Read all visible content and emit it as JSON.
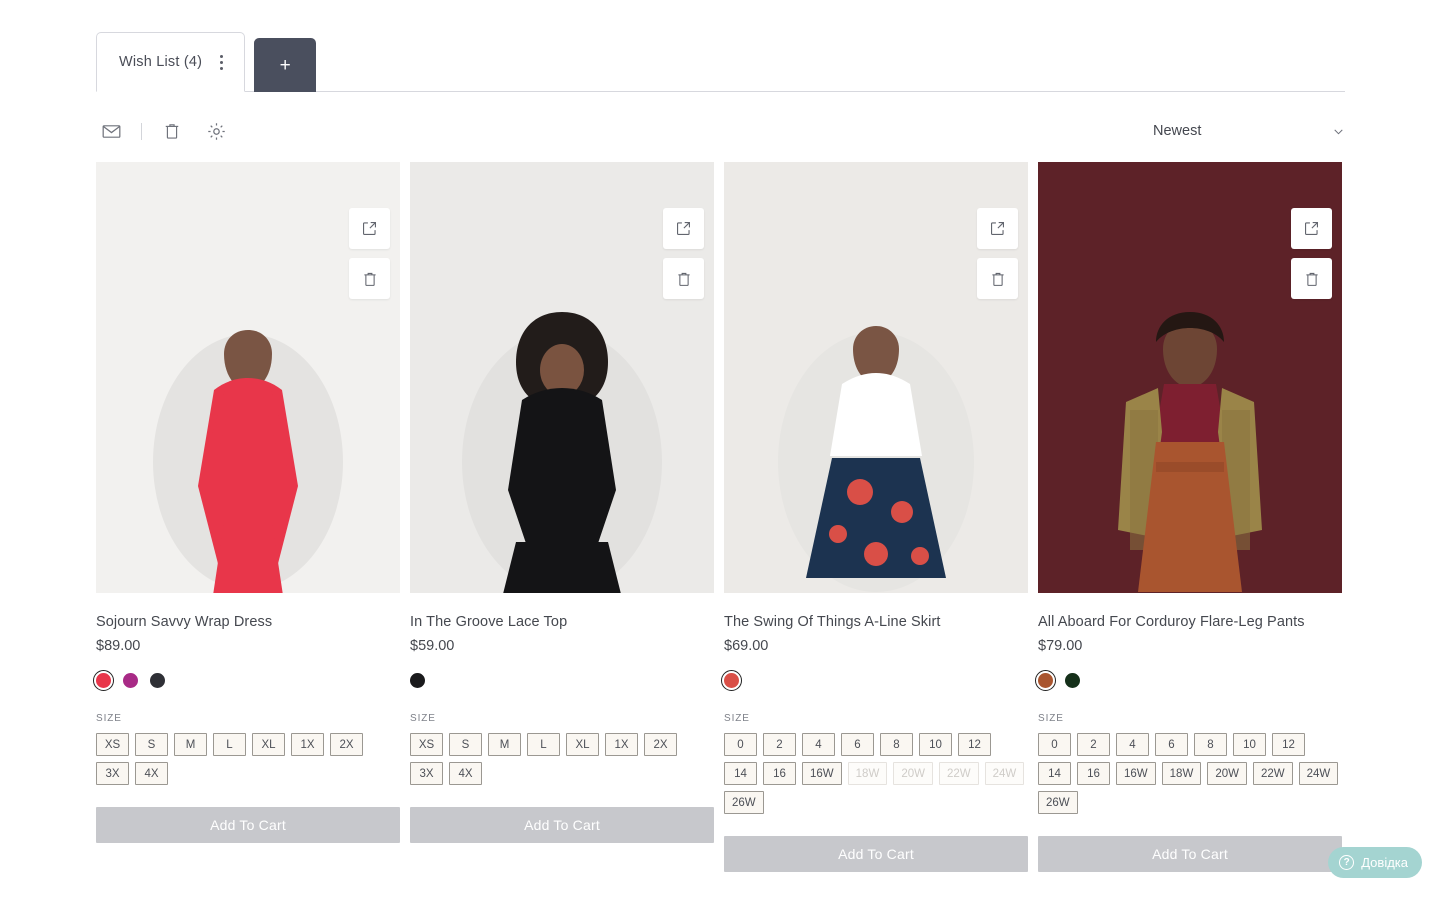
{
  "tabs": {
    "active": {
      "label": "Wish List (4)",
      "kebab_icon": "kebab-menu-icon"
    },
    "add_label": "+"
  },
  "toolbar": {
    "email_icon": "envelope-icon",
    "delete_icon": "trash-icon",
    "settings_icon": "gear-icon",
    "sort": {
      "value": "Newest",
      "chevron_icon": "chevron-down-icon"
    }
  },
  "card_actions": {
    "share_icon": "external-link-icon",
    "delete_icon": "trash-icon"
  },
  "size_heading": "SIZE",
  "add_to_cart_label": "Add To Cart",
  "help": {
    "label": "Довідка",
    "icon": "question-circle-icon",
    "color": "#a4d4d1"
  },
  "products": [
    {
      "title": "Sojourn Savvy Wrap Dress",
      "price": "$89.00",
      "bg": "#f2f1ef",
      "colors": [
        {
          "name": "red",
          "hex": "#e8364a",
          "selected": true
        },
        {
          "name": "magenta-print",
          "hex": "#a82a86",
          "selected": false
        },
        {
          "name": "charcoal",
          "hex": "#2f3036",
          "selected": false
        }
      ],
      "sizes": [
        {
          "label": "XS",
          "disabled": false
        },
        {
          "label": "S",
          "disabled": false
        },
        {
          "label": "M",
          "disabled": false
        },
        {
          "label": "L",
          "disabled": false
        },
        {
          "label": "XL",
          "disabled": false
        },
        {
          "label": "1X",
          "disabled": false
        },
        {
          "label": "2X",
          "disabled": false
        },
        {
          "label": "3X",
          "disabled": false
        },
        {
          "label": "4X",
          "disabled": false
        }
      ]
    },
    {
      "title": "In The Groove Lace Top",
      "price": "$59.00",
      "bg": "#ebeae8",
      "colors": [
        {
          "name": "black",
          "hex": "#1a1a1c",
          "selected": false
        }
      ],
      "sizes": [
        {
          "label": "XS",
          "disabled": false
        },
        {
          "label": "S",
          "disabled": false
        },
        {
          "label": "M",
          "disabled": false
        },
        {
          "label": "L",
          "disabled": false
        },
        {
          "label": "XL",
          "disabled": false
        },
        {
          "label": "1X",
          "disabled": false
        },
        {
          "label": "2X",
          "disabled": false
        },
        {
          "label": "3X",
          "disabled": false
        },
        {
          "label": "4X",
          "disabled": false
        }
      ]
    },
    {
      "title": "The Swing Of Things A-Line Skirt",
      "price": "$69.00",
      "bg": "#eceae7",
      "colors": [
        {
          "name": "floral-print",
          "hex": "#d94f47",
          "selected": true
        }
      ],
      "sizes": [
        {
          "label": "0",
          "disabled": false
        },
        {
          "label": "2",
          "disabled": false
        },
        {
          "label": "4",
          "disabled": false
        },
        {
          "label": "6",
          "disabled": false
        },
        {
          "label": "8",
          "disabled": false
        },
        {
          "label": "10",
          "disabled": false
        },
        {
          "label": "12",
          "disabled": false
        },
        {
          "label": "14",
          "disabled": false
        },
        {
          "label": "16",
          "disabled": false
        },
        {
          "label": "16W",
          "disabled": false
        },
        {
          "label": "18W",
          "disabled": true
        },
        {
          "label": "20W",
          "disabled": true
        },
        {
          "label": "22W",
          "disabled": true
        },
        {
          "label": "24W",
          "disabled": true
        },
        {
          "label": "26W",
          "disabled": false
        }
      ]
    },
    {
      "title": "All Aboard For Corduroy Flare-Leg Pants",
      "price": "$79.00",
      "bg": "#5d2228",
      "colors": [
        {
          "name": "rust",
          "hex": "#a9552f",
          "selected": true
        },
        {
          "name": "dark-green",
          "hex": "#15301a",
          "selected": false
        }
      ],
      "sizes": [
        {
          "label": "0",
          "disabled": false
        },
        {
          "label": "2",
          "disabled": false
        },
        {
          "label": "4",
          "disabled": false
        },
        {
          "label": "6",
          "disabled": false
        },
        {
          "label": "8",
          "disabled": false
        },
        {
          "label": "10",
          "disabled": false
        },
        {
          "label": "12",
          "disabled": false
        },
        {
          "label": "14",
          "disabled": false
        },
        {
          "label": "16",
          "disabled": false
        },
        {
          "label": "16W",
          "disabled": false
        },
        {
          "label": "18W",
          "disabled": false
        },
        {
          "label": "20W",
          "disabled": false
        },
        {
          "label": "22W",
          "disabled": false
        },
        {
          "label": "24W",
          "disabled": false
        },
        {
          "label": "26W",
          "disabled": false
        }
      ]
    }
  ]
}
